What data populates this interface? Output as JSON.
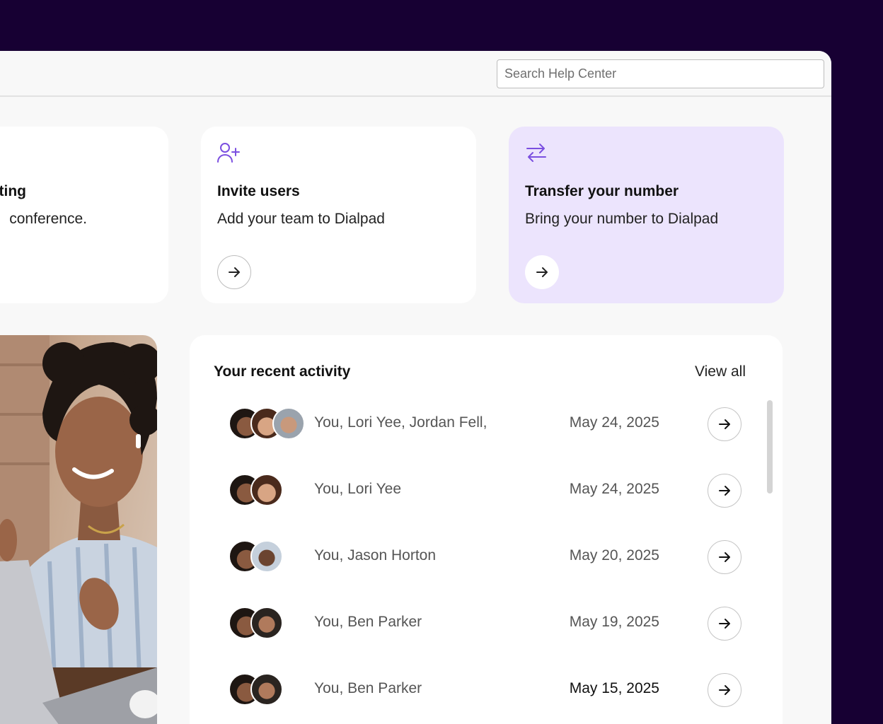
{
  "search": {
    "placeholder": "Search Help Center"
  },
  "cards": [
    {
      "title": "ting",
      "description": "conference."
    },
    {
      "title": "Invite users",
      "description": "Add your team to Dialpad",
      "icon": "user-plus-icon"
    },
    {
      "title": "Transfer your number",
      "description": "Bring your number to Dialpad",
      "icon": "arrows-swap-icon"
    }
  ],
  "activity": {
    "title": "Your recent activity",
    "view_all": "View all",
    "rows": [
      {
        "names": "You, Lori Yee, Jordan Fell,",
        "date": "May 24, 2025"
      },
      {
        "names": "You, Lori Yee",
        "date": "May 24, 2025"
      },
      {
        "names": "You, Jason Horton",
        "date": "May 20, 2025"
      },
      {
        "names": "You, Ben Parker",
        "date": "May 19, 2025"
      },
      {
        "names": "You, Ben Parker",
        "date": "May 15, 2025"
      }
    ]
  },
  "colors": {
    "page_background": "#170033",
    "accent": "#7b4fe0",
    "highlight_card": "#ece4fd"
  }
}
